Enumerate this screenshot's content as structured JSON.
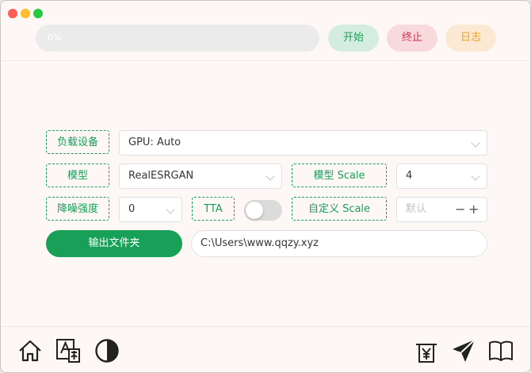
{
  "progress": {
    "text": "0%",
    "value": 0
  },
  "buttons": {
    "start": "开始",
    "stop": "终止",
    "log": "日志"
  },
  "form": {
    "device_label": "负载设备",
    "device_value": "GPU: Auto",
    "model_label": "模型",
    "model_value": "RealESRGAN",
    "model_scale_label": "模型 Scale",
    "model_scale_value": "4",
    "denoise_label": "降噪强度",
    "denoise_value": "0",
    "tta_label": "TTA",
    "tta_on": false,
    "custom_scale_label": "自定义 Scale",
    "custom_scale_placeholder": "默认",
    "output_button": "输出文件夹",
    "output_path": "C:\\Users\\www.qqzy.xyz"
  },
  "footer_icons": {
    "left": [
      "home-icon",
      "translate-icon",
      "theme-contrast-icon"
    ],
    "right": [
      "yuan-donate-icon",
      "send-icon",
      "book-icon"
    ]
  },
  "colors": {
    "primary": "#18a058",
    "error": "#d03050",
    "warning": "#f0a020",
    "background": "#fdf8f6"
  }
}
